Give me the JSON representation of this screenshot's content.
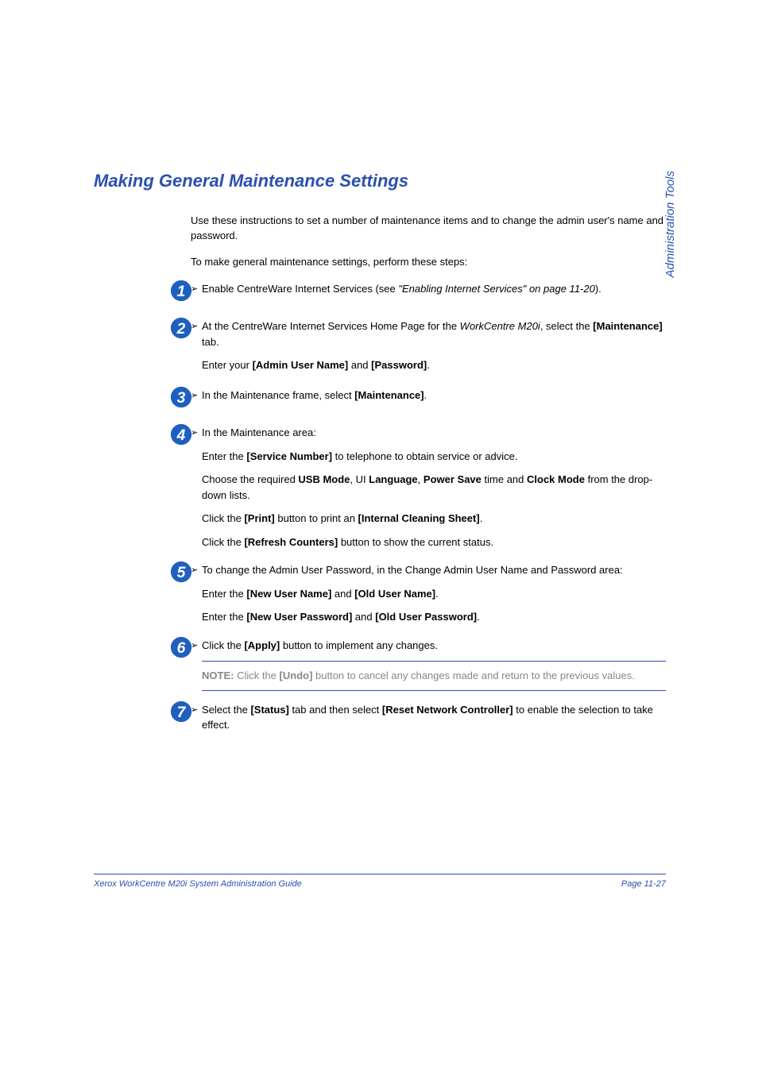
{
  "sideLabel": "Administration Tools",
  "heading": "Making General Maintenance Settings",
  "intro1": "Use these instructions to set a number of maintenance items and to change the admin user's name and password.",
  "intro2": "To make general maintenance settings, perform these steps:",
  "step1": {
    "line1_pre": "Enable CentreWare Internet Services (see ",
    "line1_ref": "\"Enabling Internet Services\" on page 11-20",
    "line1_post": ")."
  },
  "step2": {
    "line1_pre": "At the CentreWare Internet Services Home Page for the ",
    "line1_em": "WorkCentre M20i",
    "line1_mid": ", select the ",
    "line1_b": "[Maintenance]",
    "line1_post": " tab.",
    "line2_pre": "Enter your ",
    "line2_b1": "[Admin User Name]",
    "line2_mid": " and ",
    "line2_b2": "[Password]",
    "line2_post": "."
  },
  "step3": {
    "line1_pre": "In the Maintenance frame, select ",
    "line1_b": "[Maintenance]",
    "line1_post": "."
  },
  "step4": {
    "line1": "In the Maintenance area:",
    "line2_pre": "Enter the ",
    "line2_b": "[Service Number]",
    "line2_post": " to telephone to obtain service or advice.",
    "line3_pre": "Choose the required ",
    "line3_b1": "USB Mode",
    "line3_mid1": ", UI ",
    "line3_b2": "Language",
    "line3_mid2": ", ",
    "line3_b3": "Power Save",
    "line3_mid3": " time and ",
    "line3_b4": "Clock Mode",
    "line3_post": " from the drop-down lists.",
    "line4_pre": "Click the ",
    "line4_b1": "[Print]",
    "line4_mid": " button to print an ",
    "line4_b2": "[Internal Cleaning Sheet]",
    "line4_post": ".",
    "line5_pre": "Click the ",
    "line5_b": "[Refresh Counters]",
    "line5_post": " button to show the current status."
  },
  "step5": {
    "line1": "To change the Admin User Password, in the Change Admin User Name and Password area:",
    "line2_pre": "Enter the ",
    "line2_b1": "[New User Name]",
    "line2_mid": " and ",
    "line2_b2": "[Old User Name]",
    "line2_post": ".",
    "line3_pre": "Enter the ",
    "line3_b1": "[New User Password]",
    "line3_mid": " and ",
    "line3_b2": "[Old User Password]",
    "line3_post": "."
  },
  "step6": {
    "line1_pre": "Click the ",
    "line1_b": "[Apply]",
    "line1_post": " button to implement any changes.",
    "note_b": "NOTE: ",
    "note_pre": "Click the ",
    "note_b2": "[Undo]",
    "note_post": " button to cancel any changes made and return to the previous values."
  },
  "step7": {
    "line1_pre": "Select the ",
    "line1_b1": "[Status]",
    "line1_mid": " tab and then select ",
    "line1_b2": "[Reset Network Controller]",
    "line1_post": " to enable the selection to take effect."
  },
  "footer": {
    "left": "Xerox WorkCentre M20i System Administration Guide",
    "right": "Page 11-27"
  }
}
